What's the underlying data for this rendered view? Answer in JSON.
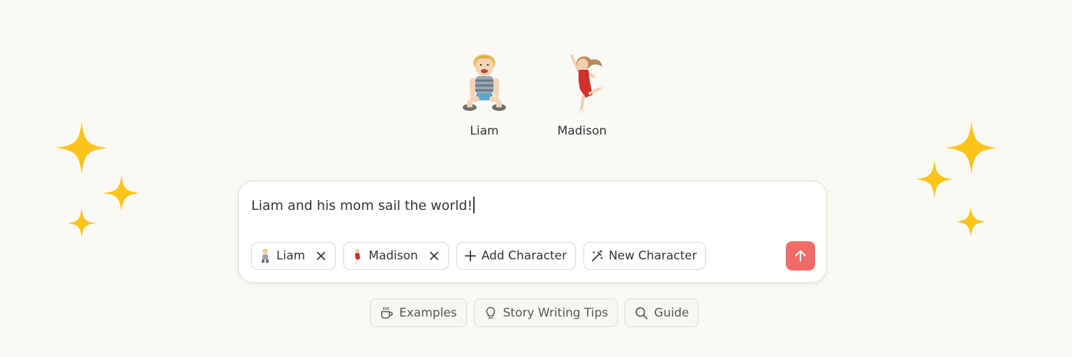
{
  "characters": [
    {
      "name": "Liam"
    },
    {
      "name": "Madison"
    }
  ],
  "prompt": {
    "text": "Liam and his mom sail the world!"
  },
  "chips": {
    "liam": "Liam",
    "madison": "Madison",
    "add_character": "Add Character",
    "new_character": "New Character"
  },
  "bottom_links": {
    "examples": "Examples",
    "tips": "Story Writing Tips",
    "guide": "Guide"
  },
  "colors": {
    "background": "#faf9f6",
    "send_button": "#f26b68",
    "sparkle": "#fcc419"
  },
  "icons": {
    "send": "arrow-up-icon",
    "remove": "close-icon",
    "add": "plus-icon",
    "new": "magic-wand-icon",
    "examples": "coffee-cup-icon",
    "tips": "lightbulb-icon",
    "guide": "search-icon"
  }
}
